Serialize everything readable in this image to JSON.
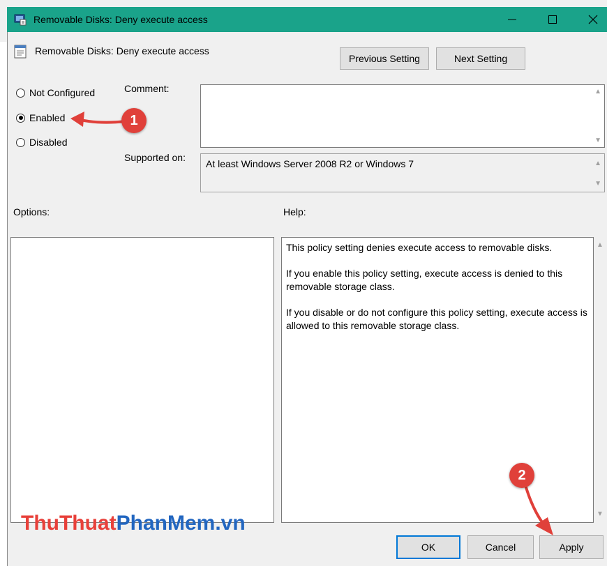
{
  "window": {
    "title": "Removable Disks: Deny execute access",
    "setting_name": "Removable Disks: Deny execute access"
  },
  "nav": {
    "previous": "Previous Setting",
    "next": "Next Setting"
  },
  "state": {
    "options": [
      "Not Configured",
      "Enabled",
      "Disabled"
    ],
    "selected": "Enabled"
  },
  "comment": {
    "label": "Comment:",
    "value": ""
  },
  "supported": {
    "label": "Supported on:",
    "value": "At least Windows Server 2008 R2 or Windows 7"
  },
  "options_label": "Options:",
  "help": {
    "label": "Help:",
    "paragraphs": [
      "This policy setting denies execute access to removable disks.",
      "If you enable this policy setting, execute access is denied to this removable storage class.",
      "If you disable or do not configure this policy setting, execute access is allowed to this removable storage class."
    ]
  },
  "footer": {
    "ok": "OK",
    "cancel": "Cancel",
    "apply": "Apply"
  },
  "annotations": {
    "badge1": "1",
    "badge2": "2",
    "arrow_color": "#e0403a"
  },
  "watermark": {
    "part1": "ThuThuat",
    "part2": "PhanMem",
    "part3": ".vn",
    "color1": "#e8403a",
    "color2": "#2266c0"
  },
  "colors": {
    "titlebar": "#1aa38a",
    "accent": "#0078d7"
  }
}
